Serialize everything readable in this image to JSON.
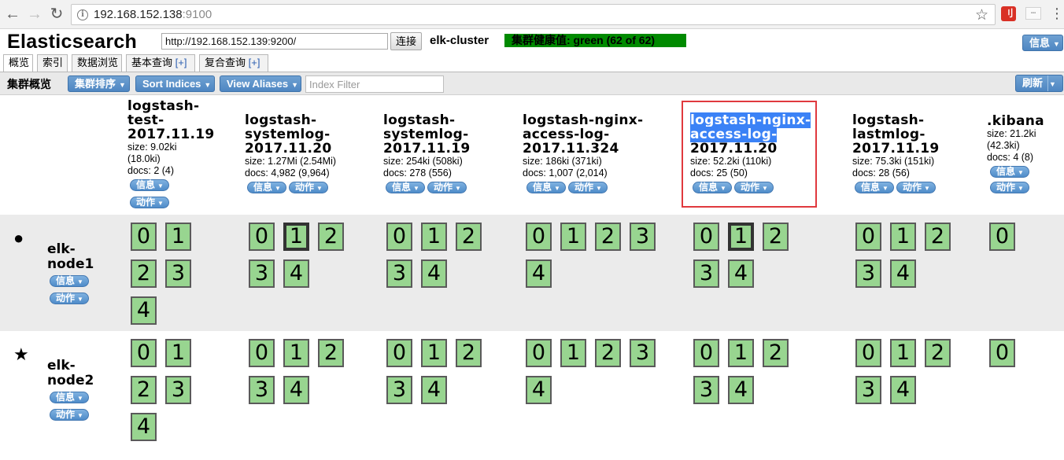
{
  "browser": {
    "url_host": "192.168.152.138",
    "url_port": ":9100",
    "ext_label": "刂"
  },
  "header": {
    "title": "Elasticsearch",
    "connection_url": "http://192.168.152.139:9200/",
    "connect_label": "连接",
    "cluster_name": "elk-cluster",
    "cluster_health": "集群健康值: green (62 of 62)",
    "health_color": "#008a00",
    "info_label": "信息"
  },
  "tabs": [
    {
      "label": "概览",
      "active": true
    },
    {
      "label": "索引",
      "active": false
    },
    {
      "label": "数据浏览",
      "active": false
    },
    {
      "label": "基本查询",
      "plus": "[+]",
      "active": false
    },
    {
      "label": "复合查询",
      "plus": "[+]",
      "active": false
    }
  ],
  "toolbar": {
    "overview_label": "集群概览",
    "sort_cluster_label": "集群排序",
    "sort_indices_label": "Sort Indices",
    "view_aliases_label": "View Aliases",
    "filter_placeholder": "Index Filter",
    "refresh_label": "刷新"
  },
  "actions": {
    "info": "信息",
    "action": "动作"
  },
  "indices": [
    {
      "name_lines": [
        "logstash-",
        "test-",
        "2017.11.19"
      ],
      "size": "size: 9.02ki",
      "size2": "(18.0ki)",
      "docs": "docs: 2 (4)"
    },
    {
      "name_lines": [
        "logstash-",
        "systemlog-",
        "2017.11.20"
      ],
      "size": "size: 1.27Mi (2.54Mi)",
      "docs": "docs: 4,982 (9,964)"
    },
    {
      "name_lines": [
        "logstash-",
        "systemlog-",
        "2017.11.19"
      ],
      "size": "size: 254ki (508ki)",
      "docs": "docs: 278 (556)"
    },
    {
      "name_lines": [
        "logstash-nginx-",
        "access-log-",
        "2017.11.324"
      ],
      "size": "size: 186ki (371ki)",
      "docs": "docs: 1,007 (2,014)"
    },
    {
      "name_lines": [
        "logstash-nginx-",
        "access-log-",
        "2017.11.20"
      ],
      "size": "size: 52.2ki (110ki)",
      "docs": "docs: 25 (50)",
      "selected": true
    },
    {
      "name_lines": [
        "logstash-",
        "lastmlog-",
        "2017.11.19"
      ],
      "size": "size: 75.3ki (151ki)",
      "docs": "docs: 28 (56)"
    },
    {
      "name_lines": [
        ".kibana"
      ],
      "size": "size: 21.2ki",
      "size2": "(42.3ki)",
      "docs": "docs: 4 (8)"
    }
  ],
  "nodes": [
    {
      "name_lines": [
        "elk-",
        "node1"
      ],
      "icon": "master-dot",
      "shards": [
        [
          "0",
          "1",
          "2",
          "3",
          "4"
        ],
        [
          "0",
          "1",
          "2",
          "3",
          "4"
        ],
        [
          "0",
          "1",
          "2",
          "3",
          "4"
        ],
        [
          "0",
          "1",
          "2",
          "3",
          "4"
        ],
        [
          "0",
          "1",
          "2",
          "3",
          "4"
        ],
        [
          "0",
          "1",
          "2",
          "3",
          "4"
        ],
        [
          "0"
        ]
      ]
    },
    {
      "name_lines": [
        "elk-",
        "node2"
      ],
      "icon": "star",
      "shards": [
        [
          "0",
          "1",
          "2",
          "3",
          "4"
        ],
        [
          "0",
          "1",
          "2",
          "3",
          "4"
        ],
        [
          "0",
          "1",
          "2",
          "3",
          "4"
        ],
        [
          "0",
          "1",
          "2",
          "3",
          "4"
        ],
        [
          "0",
          "1",
          "2",
          "3",
          "4"
        ],
        [
          "0",
          "1",
          "2",
          "3",
          "4"
        ],
        [
          "0"
        ]
      ]
    }
  ],
  "colors": {
    "shard_fill": "#98d590",
    "button_blue": "#4e86c2",
    "selection_box": "#e0393e"
  }
}
